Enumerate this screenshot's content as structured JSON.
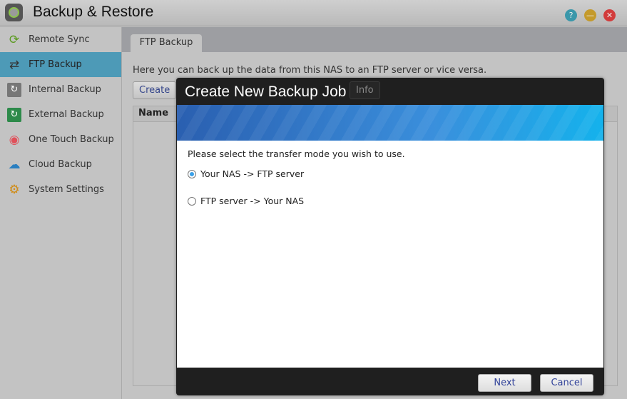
{
  "app": {
    "title": "Backup & Restore",
    "window_buttons": [
      "help",
      "minimize",
      "close"
    ]
  },
  "sidebar": {
    "items": [
      {
        "label": "Remote Sync",
        "icon": "sync-icon",
        "active": false
      },
      {
        "label": "FTP Backup",
        "icon": "server-transfer-icon",
        "active": true
      },
      {
        "label": "Internal Backup",
        "icon": "disk-icon",
        "active": false
      },
      {
        "label": "External Backup",
        "icon": "external-disk-icon",
        "active": false
      },
      {
        "label": "One Touch Backup",
        "icon": "record-icon",
        "active": false
      },
      {
        "label": "Cloud Backup",
        "icon": "cloud-icon",
        "active": false
      },
      {
        "label": "System Settings",
        "icon": "gear-icon",
        "active": false
      }
    ]
  },
  "main": {
    "tab": "FTP Backup",
    "description": "Here you can back up the data from this NAS to an FTP server or vice versa.",
    "toolbar": {
      "create": "Create",
      "info": "Info"
    },
    "table": {
      "columns": [
        "Name"
      ]
    }
  },
  "dialog": {
    "title": "Create New Backup Job",
    "prompt": "Please select the transfer mode you wish to use.",
    "options": [
      {
        "label": "Your NAS -> FTP server",
        "selected": true
      },
      {
        "label": "FTP server -> Your NAS",
        "selected": false
      }
    ],
    "next": "Next",
    "cancel": "Cancel"
  }
}
